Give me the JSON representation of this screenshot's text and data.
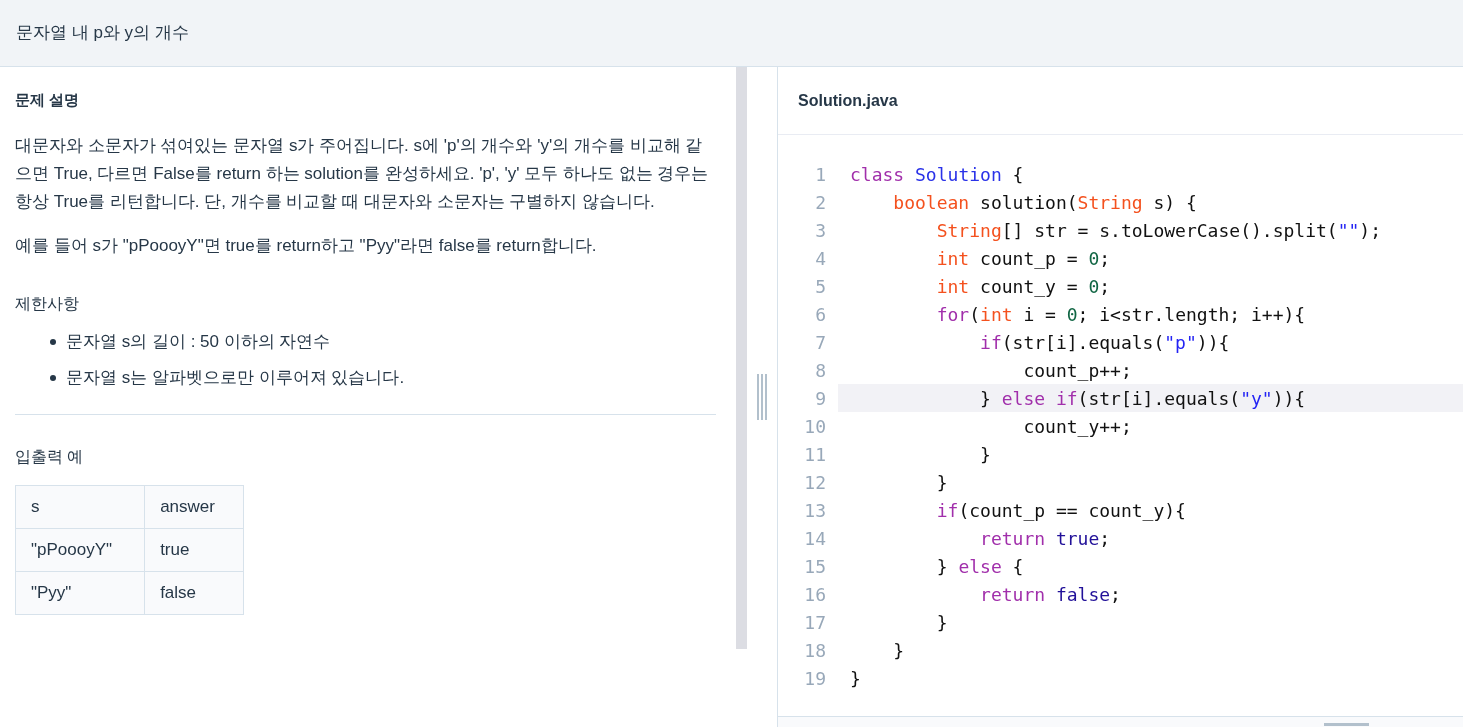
{
  "header": {
    "title": "문자열 내 p와 y의 개수"
  },
  "description": {
    "heading": "문제 설명",
    "paragraphs": [
      "대문자와 소문자가 섞여있는 문자열 s가 주어집니다. s에 'p'의 개수와 'y'의 개수를 비교해 같으면 True, 다르면 False를 return 하는 solution를 완성하세요. 'p', 'y' 모두 하나도 없는 경우는 항상 True를 리턴합니다. 단, 개수를 비교할 때 대문자와 소문자는 구별하지 않습니다.",
      "예를 들어 s가 \"pPoooyY\"면 true를 return하고 \"Pyy\"라면 false를 return합니다."
    ],
    "constraints_heading": "제한사항",
    "constraints": [
      "문자열 s의 길이 : 50 이하의 자연수",
      "문자열 s는 알파벳으로만 이루어져 있습니다."
    ],
    "examples_heading": "입출력 예",
    "table": {
      "columns": [
        "s",
        "answer"
      ],
      "rows": [
        [
          "\"pPoooyY\"",
          "true"
        ],
        [
          "\"Pyy\"",
          "false"
        ]
      ]
    }
  },
  "editor": {
    "filename": "Solution.java",
    "lines": [
      {
        "no": "1",
        "highlighted": false,
        "tokens": [
          {
            "kind": "keyword",
            "text": "class "
          },
          {
            "kind": "class",
            "text": "Solution"
          },
          {
            "kind": "plain",
            "text": " {"
          }
        ]
      },
      {
        "no": "2",
        "highlighted": false,
        "tokens": [
          {
            "kind": "type",
            "text": "    boolean"
          },
          {
            "kind": "plain",
            "text": " solution("
          },
          {
            "kind": "type",
            "text": "String"
          },
          {
            "kind": "plain",
            "text": " s) {"
          }
        ]
      },
      {
        "no": "3",
        "highlighted": false,
        "tokens": [
          {
            "kind": "type",
            "text": "        String"
          },
          {
            "kind": "plain",
            "text": "[] str = s.toLowerCase().split("
          },
          {
            "kind": "string",
            "text": "\"\""
          },
          {
            "kind": "plain",
            "text": ");"
          }
        ]
      },
      {
        "no": "4",
        "highlighted": false,
        "tokens": [
          {
            "kind": "type",
            "text": "        int"
          },
          {
            "kind": "plain",
            "text": " count_p = "
          },
          {
            "kind": "number",
            "text": "0"
          },
          {
            "kind": "plain",
            "text": ";"
          }
        ]
      },
      {
        "no": "5",
        "highlighted": false,
        "tokens": [
          {
            "kind": "type",
            "text": "        int"
          },
          {
            "kind": "plain",
            "text": " count_y = "
          },
          {
            "kind": "number",
            "text": "0"
          },
          {
            "kind": "plain",
            "text": ";"
          }
        ]
      },
      {
        "no": "6",
        "highlighted": false,
        "tokens": [
          {
            "kind": "keyword",
            "text": "        for"
          },
          {
            "kind": "plain",
            "text": "("
          },
          {
            "kind": "type",
            "text": "int"
          },
          {
            "kind": "plain",
            "text": " i = "
          },
          {
            "kind": "number",
            "text": "0"
          },
          {
            "kind": "plain",
            "text": "; i<str.length; i++){"
          }
        ]
      },
      {
        "no": "7",
        "highlighted": false,
        "tokens": [
          {
            "kind": "keyword",
            "text": "            if"
          },
          {
            "kind": "plain",
            "text": "(str[i].equals("
          },
          {
            "kind": "string",
            "text": "\"p\""
          },
          {
            "kind": "plain",
            "text": ")){"
          }
        ]
      },
      {
        "no": "8",
        "highlighted": false,
        "tokens": [
          {
            "kind": "plain",
            "text": "                count_p++;"
          }
        ]
      },
      {
        "no": "9",
        "highlighted": true,
        "tokens": [
          {
            "kind": "plain",
            "text": "            } "
          },
          {
            "kind": "keyword",
            "text": "else if"
          },
          {
            "kind": "plain",
            "text": "(str[i].equals("
          },
          {
            "kind": "string",
            "text": "\"y\""
          },
          {
            "kind": "plain",
            "text": ")){"
          }
        ]
      },
      {
        "no": "10",
        "highlighted": false,
        "tokens": [
          {
            "kind": "plain",
            "text": "                count_y++;"
          }
        ]
      },
      {
        "no": "11",
        "highlighted": false,
        "tokens": [
          {
            "kind": "plain",
            "text": "            }"
          }
        ]
      },
      {
        "no": "12",
        "highlighted": false,
        "tokens": [
          {
            "kind": "plain",
            "text": "        }"
          }
        ]
      },
      {
        "no": "13",
        "highlighted": false,
        "tokens": [
          {
            "kind": "keyword",
            "text": "        if"
          },
          {
            "kind": "plain",
            "text": "(count_p == count_y){"
          }
        ]
      },
      {
        "no": "14",
        "highlighted": false,
        "tokens": [
          {
            "kind": "keyword",
            "text": "            return "
          },
          {
            "kind": "literal",
            "text": "true"
          },
          {
            "kind": "plain",
            "text": ";"
          }
        ]
      },
      {
        "no": "15",
        "highlighted": false,
        "tokens": [
          {
            "kind": "plain",
            "text": "        } "
          },
          {
            "kind": "keyword",
            "text": "else"
          },
          {
            "kind": "plain",
            "text": " {"
          }
        ]
      },
      {
        "no": "16",
        "highlighted": false,
        "tokens": [
          {
            "kind": "keyword",
            "text": "            return "
          },
          {
            "kind": "literal",
            "text": "false"
          },
          {
            "kind": "plain",
            "text": ";"
          }
        ]
      },
      {
        "no": "17",
        "highlighted": false,
        "tokens": [
          {
            "kind": "plain",
            "text": "        }"
          }
        ]
      },
      {
        "no": "18",
        "highlighted": false,
        "tokens": [
          {
            "kind": "plain",
            "text": "    }"
          }
        ]
      },
      {
        "no": "19",
        "highlighted": false,
        "tokens": [
          {
            "kind": "plain",
            "text": "}"
          }
        ]
      }
    ]
  }
}
